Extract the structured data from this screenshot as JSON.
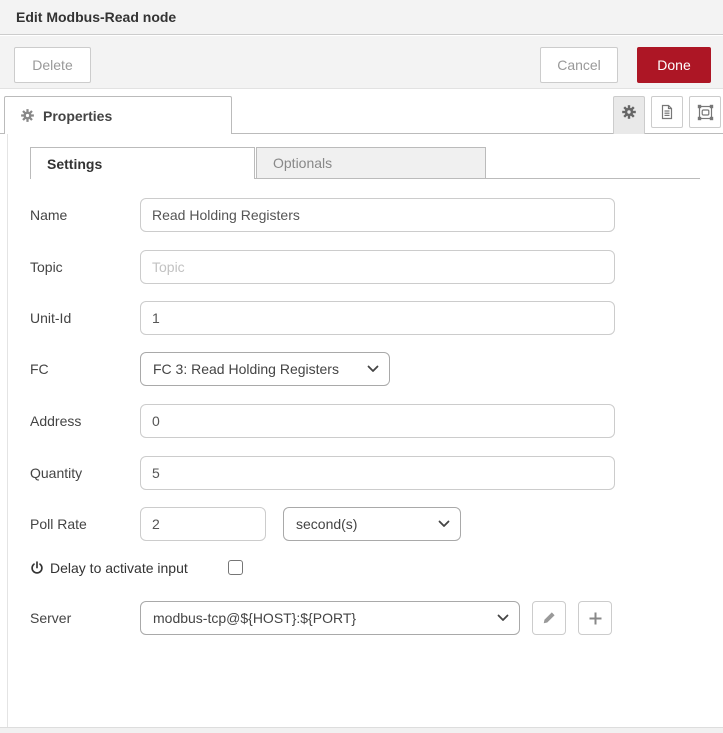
{
  "dialog": {
    "title": "Edit Modbus-Read node"
  },
  "toolbar": {
    "delete_label": "Delete",
    "cancel_label": "Cancel",
    "done_label": "Done"
  },
  "editor_tabs": {
    "properties_label": "Properties",
    "icon_buttons": [
      "gear-icon",
      "document-icon",
      "appearance-icon"
    ]
  },
  "subtabs": {
    "settings_label": "Settings",
    "optionals_label": "Optionals"
  },
  "form": {
    "name": {
      "label": "Name",
      "value": "Read Holding Registers"
    },
    "topic": {
      "label": "Topic",
      "placeholder": "Topic"
    },
    "unit_id": {
      "label": "Unit-Id",
      "value": "1"
    },
    "fc": {
      "label": "FC",
      "value": "FC 3: Read Holding Registers"
    },
    "address": {
      "label": "Address",
      "value": "0"
    },
    "quantity": {
      "label": "Quantity",
      "value": "5"
    },
    "poll_rate": {
      "label": "Poll Rate",
      "value": "2",
      "unit_value": "second(s)"
    },
    "delay": {
      "label": "Delay to activate input",
      "checked": false
    },
    "server": {
      "label": "Server",
      "value": "modbus-tcp@${HOST}:${PORT}"
    }
  },
  "icons": {
    "properties_tab": "gear-icon",
    "delay_row": "power-icon",
    "server_edit": "pencil-icon",
    "server_add": "plus-icon",
    "selects": "chevron-down-icon"
  },
  "colors": {
    "accent_red": "#AD1625",
    "header_bg": "#f3f3f3",
    "tab_border": "#bbbbbb",
    "input_border": "#cccccc"
  }
}
